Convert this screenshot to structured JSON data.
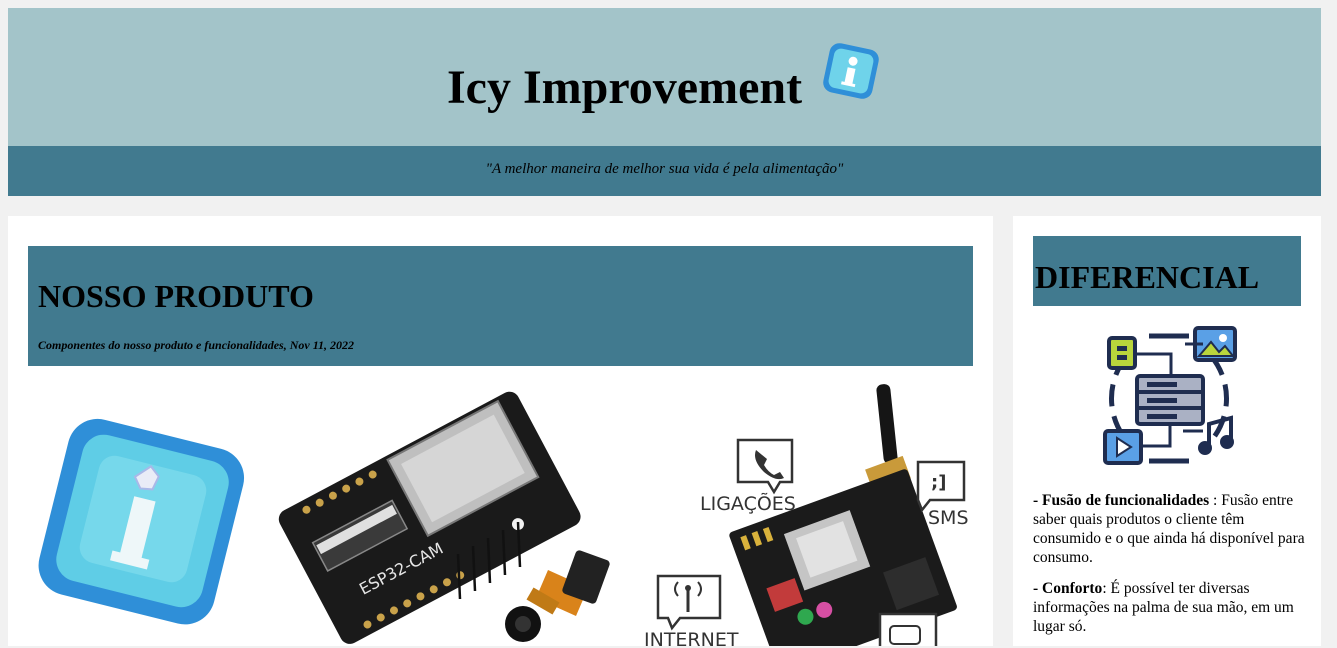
{
  "header": {
    "title": "Icy Improvement",
    "title_icon": "info-icon",
    "quote": "\"A melhor maneira de melhor sua vida é pela alimentação\""
  },
  "main": {
    "section_title": "NOSSO PRODUTO",
    "section_subtitle": "Componentes do nosso produto e funcionalidades, Nov 11, 2022",
    "image_labels": {
      "board": "ESP32-CAM",
      "calls": "LIGAÇÕES",
      "sms": "SMS",
      "sms_glyph": ";]",
      "internet": "INTERNET"
    }
  },
  "sidebar": {
    "title": "DIFERENCIAL",
    "illustration": "multimedia-server-icon",
    "items": [
      {
        "bold": "- Fusão de funcionalidades",
        "sep": " : ",
        "text": "Fusão entre saber quais produtos o cliente têm consumido e o que ainda há disponível para consumo."
      },
      {
        "bold": "- Conforto",
        "sep": ": ",
        "text": "É possível ter diversas informações na palma de sua mão, em um lugar só."
      }
    ]
  },
  "colors": {
    "page_bg": "#f1f1f1",
    "title_band": "#a3c4c9",
    "accent_band": "#417a8f",
    "card": "#ffffff"
  }
}
